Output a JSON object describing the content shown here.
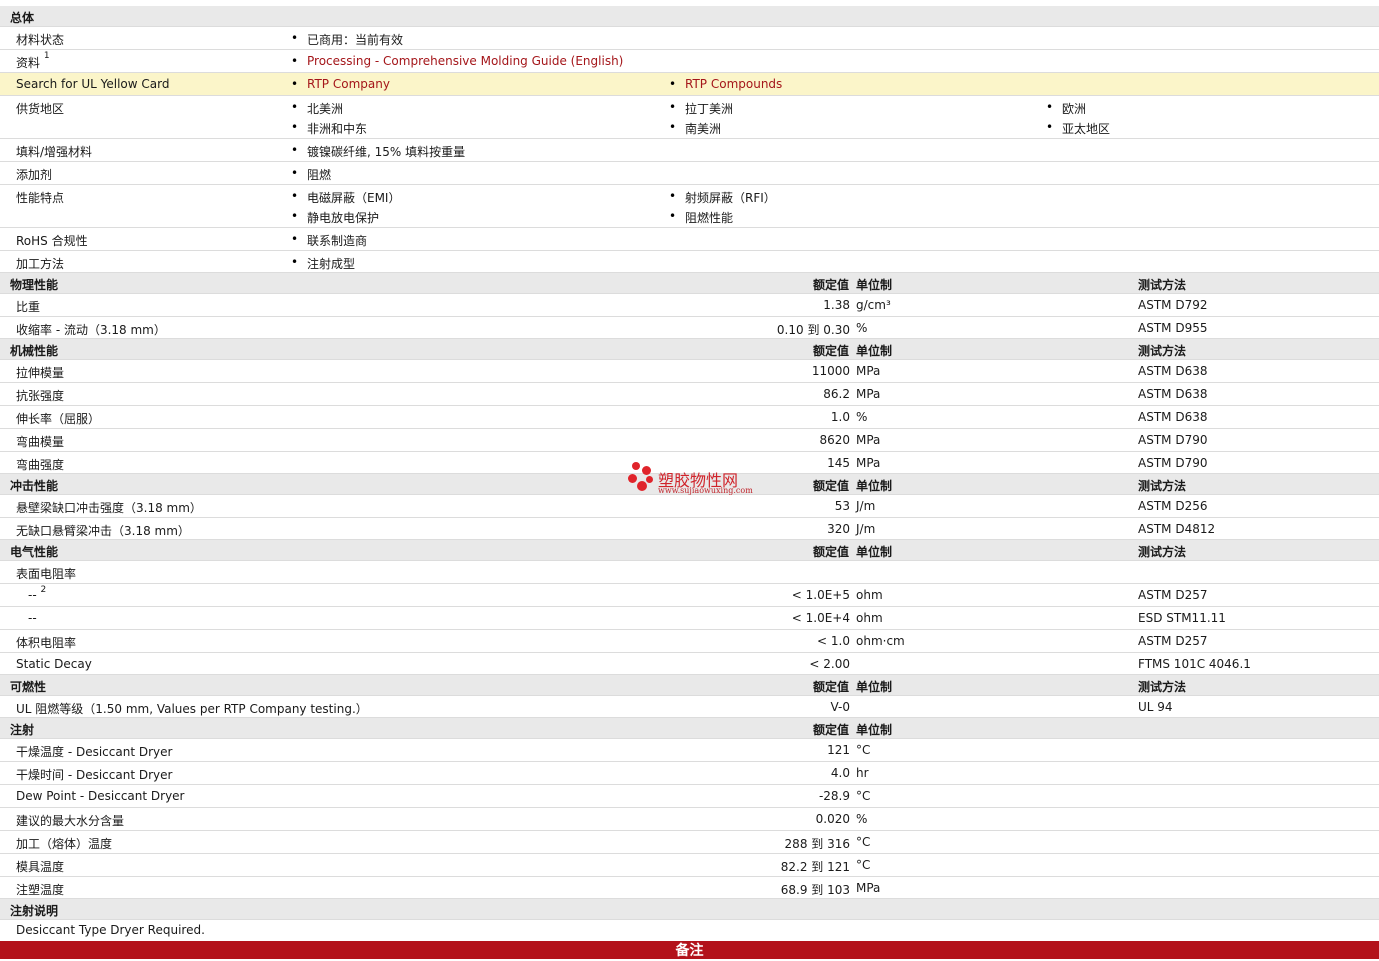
{
  "general": {
    "title": "总体",
    "status_label": "材料状态",
    "status_value": "已商用：当前有效",
    "docs_label": "资料",
    "docs_sup": "1",
    "docs_link": "Processing - Comprehensive Molding Guide (English)",
    "ul_label": "Search for UL Yellow Card",
    "ul_link1": "RTP Company",
    "ul_link2": "RTP Compounds",
    "supply_label": "供货地区",
    "supply": [
      "北美洲",
      "拉丁美洲",
      "欧洲",
      "非洲和中东",
      "南美洲",
      "亚太地区"
    ],
    "filler_label": "填料/增强材料",
    "filler_value": "镀镍碳纤维, 15% 填料按重量",
    "additive_label": "添加剂",
    "additive_value": "阻燃",
    "features_label": "性能特点",
    "features": [
      "电磁屏蔽（EMI）",
      "射频屏蔽（RFI）",
      "静电放电保护",
      "阻燃性能"
    ],
    "rohs_label": "RoHS 合规性",
    "rohs_value": "联系制造商",
    "process_label": "加工方法",
    "process_value": "注射成型"
  },
  "col_headers": {
    "nominal": "额定值",
    "unit": "单位制",
    "method": "测试方法"
  },
  "physical": {
    "title": "物理性能",
    "rows": [
      {
        "label": "比重",
        "value": "1.38",
        "unit": "g/cm³",
        "method": "ASTM D792"
      },
      {
        "label": "收缩率 - 流动（3.18 mm）",
        "value": "0.10 到 0.30",
        "unit": "%",
        "method": "ASTM D955"
      }
    ]
  },
  "mechanical": {
    "title": "机械性能",
    "rows": [
      {
        "label": "拉伸模量",
        "value": "11000",
        "unit": "MPa",
        "method": "ASTM D638"
      },
      {
        "label": "抗张强度",
        "value": "86.2",
        "unit": "MPa",
        "method": "ASTM D638"
      },
      {
        "label": "伸长率（屈服）",
        "value": "1.0",
        "unit": "%",
        "method": "ASTM D638"
      },
      {
        "label": "弯曲模量",
        "value": "8620",
        "unit": "MPa",
        "method": "ASTM D790"
      },
      {
        "label": "弯曲强度",
        "value": "145",
        "unit": "MPa",
        "method": "ASTM D790"
      }
    ]
  },
  "impact": {
    "title": "冲击性能",
    "rows": [
      {
        "label": "悬壁梁缺口冲击强度（3.18 mm）",
        "value": "53",
        "unit": "J/m",
        "method": "ASTM D256"
      },
      {
        "label": "无缺口悬臂梁冲击（3.18 mm）",
        "value": "320",
        "unit": "J/m",
        "method": "ASTM D4812"
      }
    ]
  },
  "electrical": {
    "title": "电气性能",
    "surface_label": "表面电阻率",
    "rows": [
      {
        "label": "--",
        "sup": "2",
        "value": "< 1.0E+5",
        "unit": "ohm",
        "method": "ASTM D257"
      },
      {
        "label": "--",
        "value": "< 1.0E+4",
        "unit": "ohm",
        "method": "ESD STM11.11"
      },
      {
        "label": "体积电阻率",
        "value": "< 1.0",
        "unit": "ohm·cm",
        "method": "ASTM D257"
      },
      {
        "label": "Static Decay",
        "value": "< 2.00",
        "unit": "",
        "method": "FTMS 101C 4046.1"
      }
    ]
  },
  "flammability": {
    "title": "可燃性",
    "rows": [
      {
        "label": "UL 阻燃等级（1.50 mm, Values per RTP Company testing.）",
        "value": "V-0",
        "unit": "",
        "method": "UL 94"
      }
    ]
  },
  "injection": {
    "title": "注射",
    "rows": [
      {
        "label": "干燥温度 - Desiccant Dryer",
        "value": "121",
        "unit": "°C"
      },
      {
        "label": "干燥时间 - Desiccant Dryer",
        "value": "4.0",
        "unit": "hr"
      },
      {
        "label": "Dew Point - Desiccant Dryer",
        "value": "-28.9",
        "unit": "°C"
      },
      {
        "label": "建议的最大水分含量",
        "value": "0.020",
        "unit": "%"
      },
      {
        "label": "加工（熔体）温度",
        "value": "288 到 316",
        "unit": "°C"
      },
      {
        "label": "模具温度",
        "value": "82.2 到 121",
        "unit": "°C"
      },
      {
        "label": "注塑温度",
        "value": "68.9 到 103",
        "unit": "MPa"
      }
    ]
  },
  "injection_notes": {
    "title": "注射说明",
    "text": "Desiccant Type Dryer Required."
  },
  "footer": {
    "title": "备注"
  },
  "watermark": {
    "name": "塑胶物性网",
    "url": "www.sujiaowuxing.com"
  }
}
